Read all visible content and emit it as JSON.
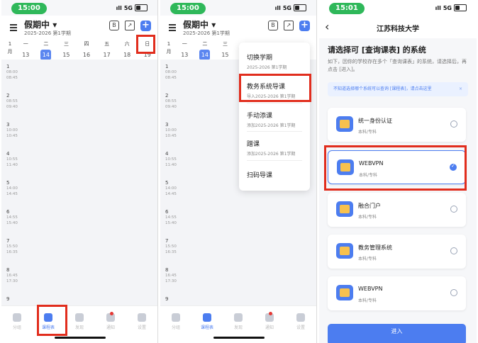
{
  "panel1": {
    "status": {
      "time": "15:00",
      "network": "5G"
    },
    "header": {
      "term": "假期中",
      "term_caret": "▾",
      "term_sub": "2025-2026 第1学期",
      "icon_b_label": "B",
      "plus_label": "+"
    },
    "week": {
      "month_num": "1",
      "month_label": "月",
      "days": [
        {
          "name": "一",
          "num": "13"
        },
        {
          "name": "二",
          "num": "14"
        },
        {
          "name": "三",
          "num": "15"
        },
        {
          "name": "四",
          "num": "16"
        },
        {
          "name": "五",
          "num": "17"
        },
        {
          "name": "六",
          "num": "18"
        },
        {
          "name": "日",
          "num": "19"
        }
      ]
    },
    "slots": [
      {
        "idx": "1",
        "start": "08:00",
        "end": "08:45"
      },
      {
        "idx": "2",
        "start": "08:55",
        "end": "09:40"
      },
      {
        "idx": "3",
        "start": "10:00",
        "end": "10:45"
      },
      {
        "idx": "4",
        "start": "10:55",
        "end": "11:40"
      },
      {
        "idx": "5",
        "start": "14:00",
        "end": "14:45"
      },
      {
        "idx": "6",
        "start": "14:55",
        "end": "15:40"
      },
      {
        "idx": "7",
        "start": "15:50",
        "end": "16:35"
      },
      {
        "idx": "8",
        "start": "16:45",
        "end": "17:30"
      },
      {
        "idx": "9",
        "start": "",
        "end": ""
      }
    ],
    "tabs": [
      "分组",
      "课程表",
      "发现",
      "通知",
      "设置"
    ]
  },
  "panel2": {
    "status": {
      "time": "15:00",
      "network": "5G"
    },
    "header": {
      "term": "假期中",
      "term_caret": "▾",
      "term_sub": "2025-2026 第1学期",
      "icon_b_label": "B",
      "plus_label": "+"
    },
    "week_days": [
      {
        "name": "一",
        "num": "13"
      },
      {
        "name": "二",
        "num": "14"
      },
      {
        "name": "三",
        "num": "15"
      }
    ],
    "menu": [
      {
        "title": "切换学期",
        "sub": "2025-2026 第1学期"
      },
      {
        "title": "教务系统导课",
        "sub": "导入2025-2026 第1学期"
      },
      {
        "title": "手动添课",
        "sub": "添加2025-2026 第1学期"
      },
      {
        "title": "蹭课",
        "sub": "添加2025-2026 第1学期"
      },
      {
        "title": "扫码导课",
        "sub": ""
      }
    ]
  },
  "panel3": {
    "status": {
      "time": "15:01",
      "network": "5G"
    },
    "nav_title": "江苏科技大学",
    "back_glyph": "‹",
    "question": "请选择可 [查询课表] 的系统",
    "desc": "如下，因你的学校存在多个「查询课表」的系统，请选择后，再点击 [进入]。",
    "hint": "不知道选择哪个系统可以查询 [课程表]，请点击这里",
    "hint_close": "×",
    "systems": [
      {
        "name": "统一身份认证",
        "type": "本科/专科",
        "selected": false
      },
      {
        "name": "WEBVPN",
        "type": "本科/专科",
        "selected": true
      },
      {
        "name": "融合门户",
        "type": "本科/专科",
        "selected": false
      },
      {
        "name": "教务管理系统",
        "type": "本科/专科",
        "selected": false
      },
      {
        "name": "WEBVPN",
        "type": "本科/专科",
        "selected": false
      }
    ],
    "enter_label": "进入"
  },
  "colors": {
    "accent": "#4c7df0",
    "highlight": "#e12d1d",
    "status_green": "#2fb85a"
  }
}
